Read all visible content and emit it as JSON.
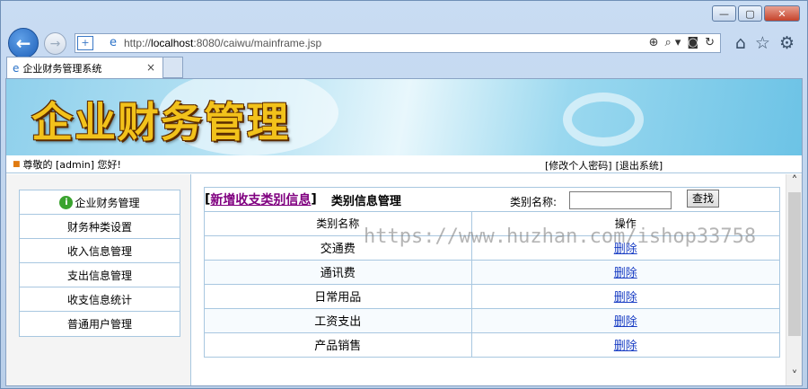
{
  "window": {
    "minimize": "—",
    "maximize": "▢",
    "close": "✕"
  },
  "browser": {
    "back": "←",
    "forward": "→",
    "url_prefix": "http://",
    "url_host": "localhost",
    "url_rest": ":8080/caiwu/mainframe.jsp",
    "addr_icons": [
      "⊕",
      "⌕ ▾",
      "◙",
      "↻"
    ],
    "tool_icons": [
      "⌂",
      "☆",
      "⚙"
    ],
    "tab_title": "企业财务管理系统",
    "tab_close": "×"
  },
  "banner": {
    "title": "企业财务管理"
  },
  "userbar": {
    "greeting": "尊敬的 [admin] 您好!",
    "change_password": "[修改个人密码]",
    "logout": "[退出系统]"
  },
  "sidebar": {
    "header": "企业财务管理",
    "items": [
      {
        "label": "财务种类设置"
      },
      {
        "label": "收入信息管理"
      },
      {
        "label": "支出信息管理"
      },
      {
        "label": "收支信息统计"
      },
      {
        "label": "普通用户管理"
      }
    ]
  },
  "panel": {
    "add_link": "新增收支类别信息",
    "title": "类别信息管理",
    "search_label": "类别名称:",
    "search_value": "",
    "search_button": "查找",
    "columns": [
      "类别名称",
      "操作"
    ],
    "rows": [
      {
        "name": "交通费",
        "action": "删除"
      },
      {
        "name": "通讯费",
        "action": "删除"
      },
      {
        "name": "日常用品",
        "action": "删除"
      },
      {
        "name": "工资支出",
        "action": "删除"
      },
      {
        "name": "产品销售",
        "action": "删除"
      }
    ]
  },
  "watermark": "https://www.huzhan.com/ishop33758"
}
